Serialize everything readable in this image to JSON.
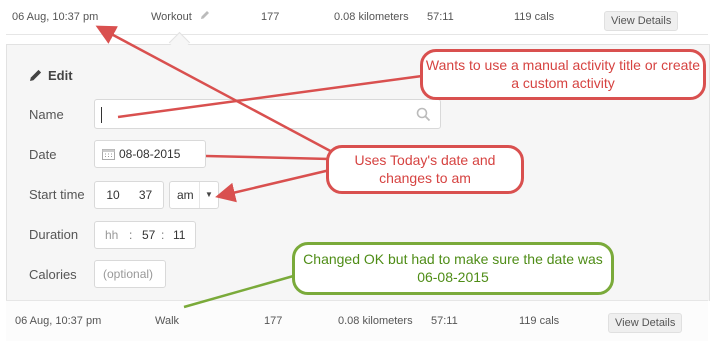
{
  "activity_rows": [
    {
      "datetime": "06 Aug, 10:37 pm",
      "activity": "Workout",
      "steps": "177",
      "distance": "0.08 kilometers",
      "duration": "57:11",
      "calories": "119 cals",
      "details_label": "View Details"
    },
    {
      "datetime": "06 Aug, 10:37 pm",
      "activity": "Walk",
      "steps": "177",
      "distance": "0.08 kilometers",
      "duration": "57:11",
      "calories": "119 cals",
      "details_label": "View Details"
    }
  ],
  "edit_form": {
    "title": "Edit",
    "name_label": "Name",
    "name_value": "",
    "date_label": "Date",
    "date_value": "08-08-2015",
    "start_time_label": "Start time",
    "start_hour": "10",
    "start_minute": "37",
    "start_ampm": "am",
    "duration_label": "Duration",
    "duration_hh": "hh",
    "duration_mm": "57",
    "duration_ss": "11",
    "calories_label": "Calories",
    "calories_placeholder": "(optional)",
    "time_separator": ":"
  },
  "annotations": [
    {
      "text": "Wants to use a manual activity title or create a custom activity",
      "color": "#d64341"
    },
    {
      "text": "Uses Today's date and changes to am",
      "color": "#d64341"
    },
    {
      "text": "Changed OK but had to make sure the date was 06-08-2015",
      "color": "#4f8d17"
    }
  ],
  "icons": [
    "pencil-icon",
    "search-icon",
    "calendar-icon",
    "chevron-down-icon"
  ]
}
